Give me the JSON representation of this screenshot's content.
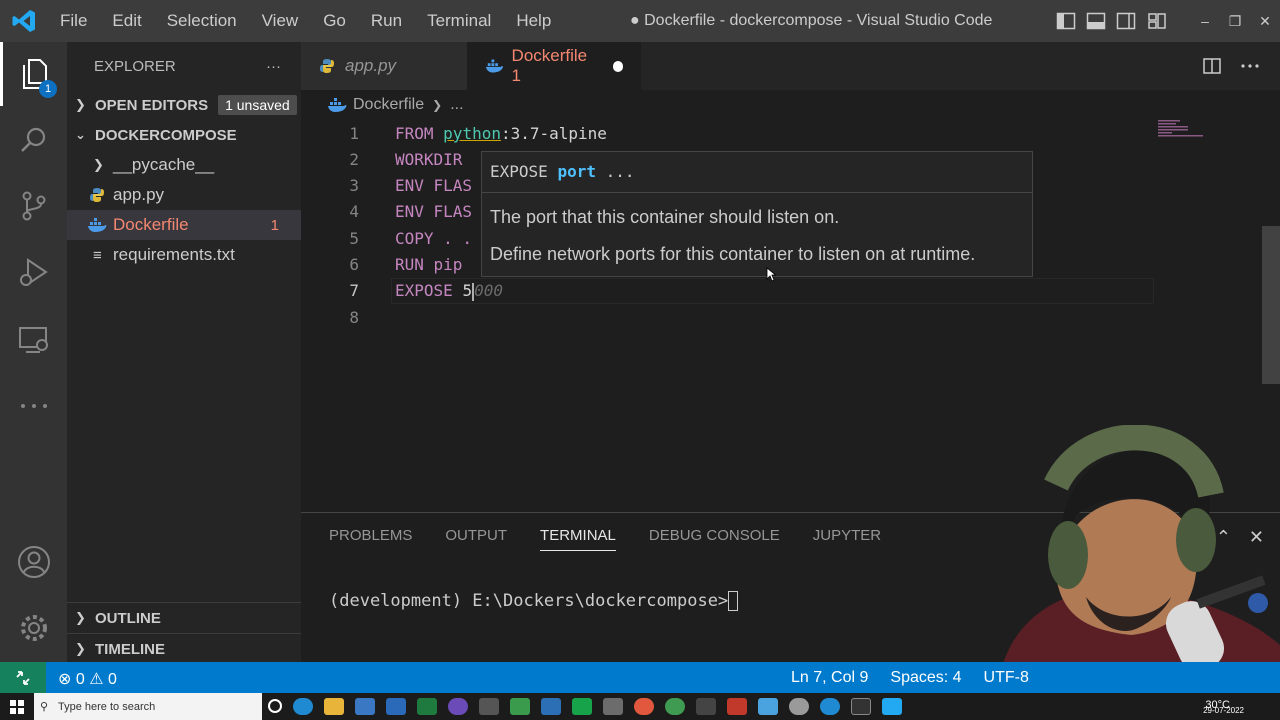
{
  "titlebar": {
    "menu": [
      "File",
      "Edit",
      "Selection",
      "View",
      "Go",
      "Run",
      "Terminal",
      "Help"
    ],
    "title": "● Dockerfile - dockercompose - Visual Studio Code"
  },
  "activitybar": {
    "explorer_badge": "1",
    "icons": [
      "explorer-icon",
      "search-icon",
      "source-control-icon",
      "run-debug-icon",
      "remote-explorer-icon",
      "more-icon",
      "account-icon",
      "settings-gear-icon"
    ]
  },
  "sidebar": {
    "header": "EXPLORER",
    "more": "···",
    "open_editors": {
      "label": "OPEN EDITORS",
      "badge": "1 unsaved"
    },
    "project": "DOCKERCOMPOSE",
    "items": [
      {
        "label": "__pycache__",
        "type": "folder"
      },
      {
        "label": "app.py",
        "type": "python"
      },
      {
        "label": "Dockerfile",
        "type": "docker",
        "problems": "1"
      },
      {
        "label": "requirements.txt",
        "type": "text"
      }
    ],
    "outline": "OUTLINE",
    "timeline": "TIMELINE"
  },
  "tabs": [
    {
      "label": "app.py"
    },
    {
      "label": "Dockerfile 1"
    }
  ],
  "breadcrumb": {
    "file": "Dockerfile",
    "rest": "..."
  },
  "editor": {
    "lines": [
      "1",
      "2",
      "3",
      "4",
      "5",
      "6",
      "7",
      "8"
    ],
    "code": {
      "l1_kw": "FROM",
      "l1_img": "python",
      "l1_rest": ":3.7-alpine",
      "l2": "WORKDIR",
      "l3": "ENV FLAS",
      "l4": "ENV FLAS",
      "l5": "COPY . .",
      "l6": "RUN pip",
      "l7_kw": "EXPOSE",
      "l7_typed": "5",
      "l7_ghost": "000"
    }
  },
  "hover": {
    "sig_kw": "EXPOSE",
    "sig_param": "port",
    "sig_rest": "...",
    "line1": "The port that this container should listen on.",
    "line2": "Define network ports for this container to listen on at runtime."
  },
  "panel": {
    "tabs": [
      "PROBLEMS",
      "OUTPUT",
      "TERMINAL",
      "DEBUG CONSOLE",
      "JUPYTER"
    ],
    "active_tab": "TERMINAL",
    "prompt": "(development) E:\\Dockers\\dockercompose>"
  },
  "statusbar": {
    "errors": "0",
    "warnings": "0",
    "position": "Ln 7, Col 9",
    "spaces": "Spaces: 4",
    "encoding": "UTF-8"
  },
  "taskbar": {
    "search_placeholder": "Type here to search",
    "temperature": "30°C",
    "date": "29-07-2022"
  },
  "colors": {
    "accent": "#007acc",
    "error": "#f48771",
    "keyword": "#c586c0"
  }
}
